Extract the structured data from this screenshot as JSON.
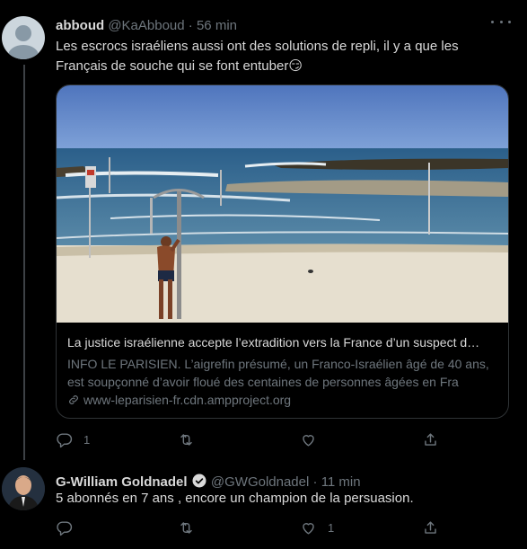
{
  "tweets": [
    {
      "author": {
        "name": "abboud",
        "handle": "@KaAbboud",
        "time": "56 min"
      },
      "text": "Les escrocs israéliens aussi ont des solutions de repli, il y a que les Français de souche qui se font entuber",
      "emoji": "😏",
      "card": {
        "title": "La justice israélienne accepte l’extradition vers la France d’un suspect d…",
        "description": "INFO LE PARISIEN. L’aigrefin présumé, un Franco-Israélien âgé de 40 ans, est soupçonné d’avoir floué des centaines de personnes âgées en Fra",
        "domain": "www-leparisien-fr.cdn.ampproject.org"
      },
      "actions": {
        "reply_count": "1",
        "retweet_count": "",
        "like_count": ""
      }
    },
    {
      "author": {
        "name": "G-William Goldnadel",
        "handle": "@GWGoldnadel",
        "time": "11 min",
        "verified": true
      },
      "text": "5 abonnés en 7 ans , encore un champion de la persuasion.",
      "actions": {
        "reply_count": "",
        "retweet_count": "",
        "like_count": "1"
      }
    }
  ],
  "separator": "·",
  "colors": {
    "background": "#000000",
    "text": "#d9d9d9",
    "muted": "#6e767d",
    "border": "#2f3336"
  },
  "icons": [
    "default-avatar-icon",
    "more-icon",
    "link-icon",
    "reply-icon",
    "retweet-icon",
    "like-icon",
    "share-icon",
    "verified-badge-icon"
  ]
}
